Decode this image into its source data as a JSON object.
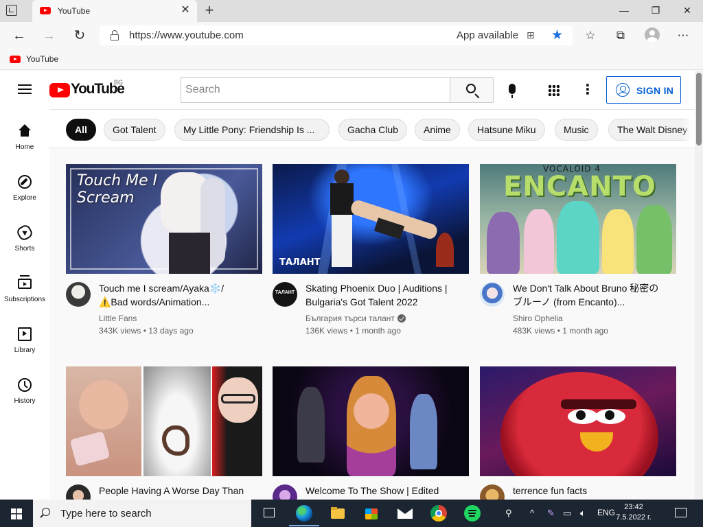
{
  "browser": {
    "tab_title": "YouTube",
    "url": "https://www.youtube.com",
    "app_available": "App available",
    "favorites": [
      "YouTube"
    ]
  },
  "header": {
    "logo_text": "YouTube",
    "country_code": "BG",
    "search_placeholder": "Search",
    "signin_label": "SIGN IN"
  },
  "guide": [
    {
      "label": "Home",
      "icon": "home-icon"
    },
    {
      "label": "Explore",
      "icon": "explore-icon"
    },
    {
      "label": "Shorts",
      "icon": "shorts-icon"
    },
    {
      "label": "Subscriptions",
      "icon": "subscriptions-icon"
    },
    {
      "label": "Library",
      "icon": "library-icon"
    },
    {
      "label": "History",
      "icon": "history-icon"
    }
  ],
  "chips": [
    "All",
    "Got Talent",
    "My Little Pony: Friendship Is ...",
    "Gacha Club",
    "Anime",
    "Hatsune Miku",
    "Music",
    "The Walt Disney"
  ],
  "videos": [
    {
      "title": "Touch me I scream/Ayaka❄️/ ⚠️Bad words/Animation...",
      "channel": "Little Fans",
      "views": "343K views",
      "age": "13 days ago",
      "thumb_caption": "Touch Me I Scream"
    },
    {
      "title": "Skating Phoenix Duo | Auditions | Bulgaria's Got Talent 2022",
      "channel": "България търси талант",
      "verified": true,
      "views": "136K views",
      "age": "1 month ago",
      "thumb_caption": "ТАЛАНТ",
      "avatar_text": "ТАЛАНТ"
    },
    {
      "title": "We Don't Talk About Bruno 秘密のブルーノ (from Encanto)...",
      "channel": "Shiro Ophelia",
      "views": "483K views",
      "age": "1 month ago",
      "thumb_caption": "ENCANTO",
      "thumb_caption_2": "VOCALOID 4"
    },
    {
      "title": "People Having A Worse Day Than"
    },
    {
      "title": "Welcome To The Show | Edited"
    },
    {
      "title": "terrence fun facts"
    }
  ],
  "taskbar": {
    "search_placeholder": "Type here to search",
    "language": "ENG",
    "time": "23:42",
    "date": "7.5.2022 г."
  },
  "colors": {
    "youtube_red": "#ff0000",
    "link_blue": "#065fd4",
    "favorite_star": "#1e6fd9",
    "taskbar": "#1c2532"
  }
}
